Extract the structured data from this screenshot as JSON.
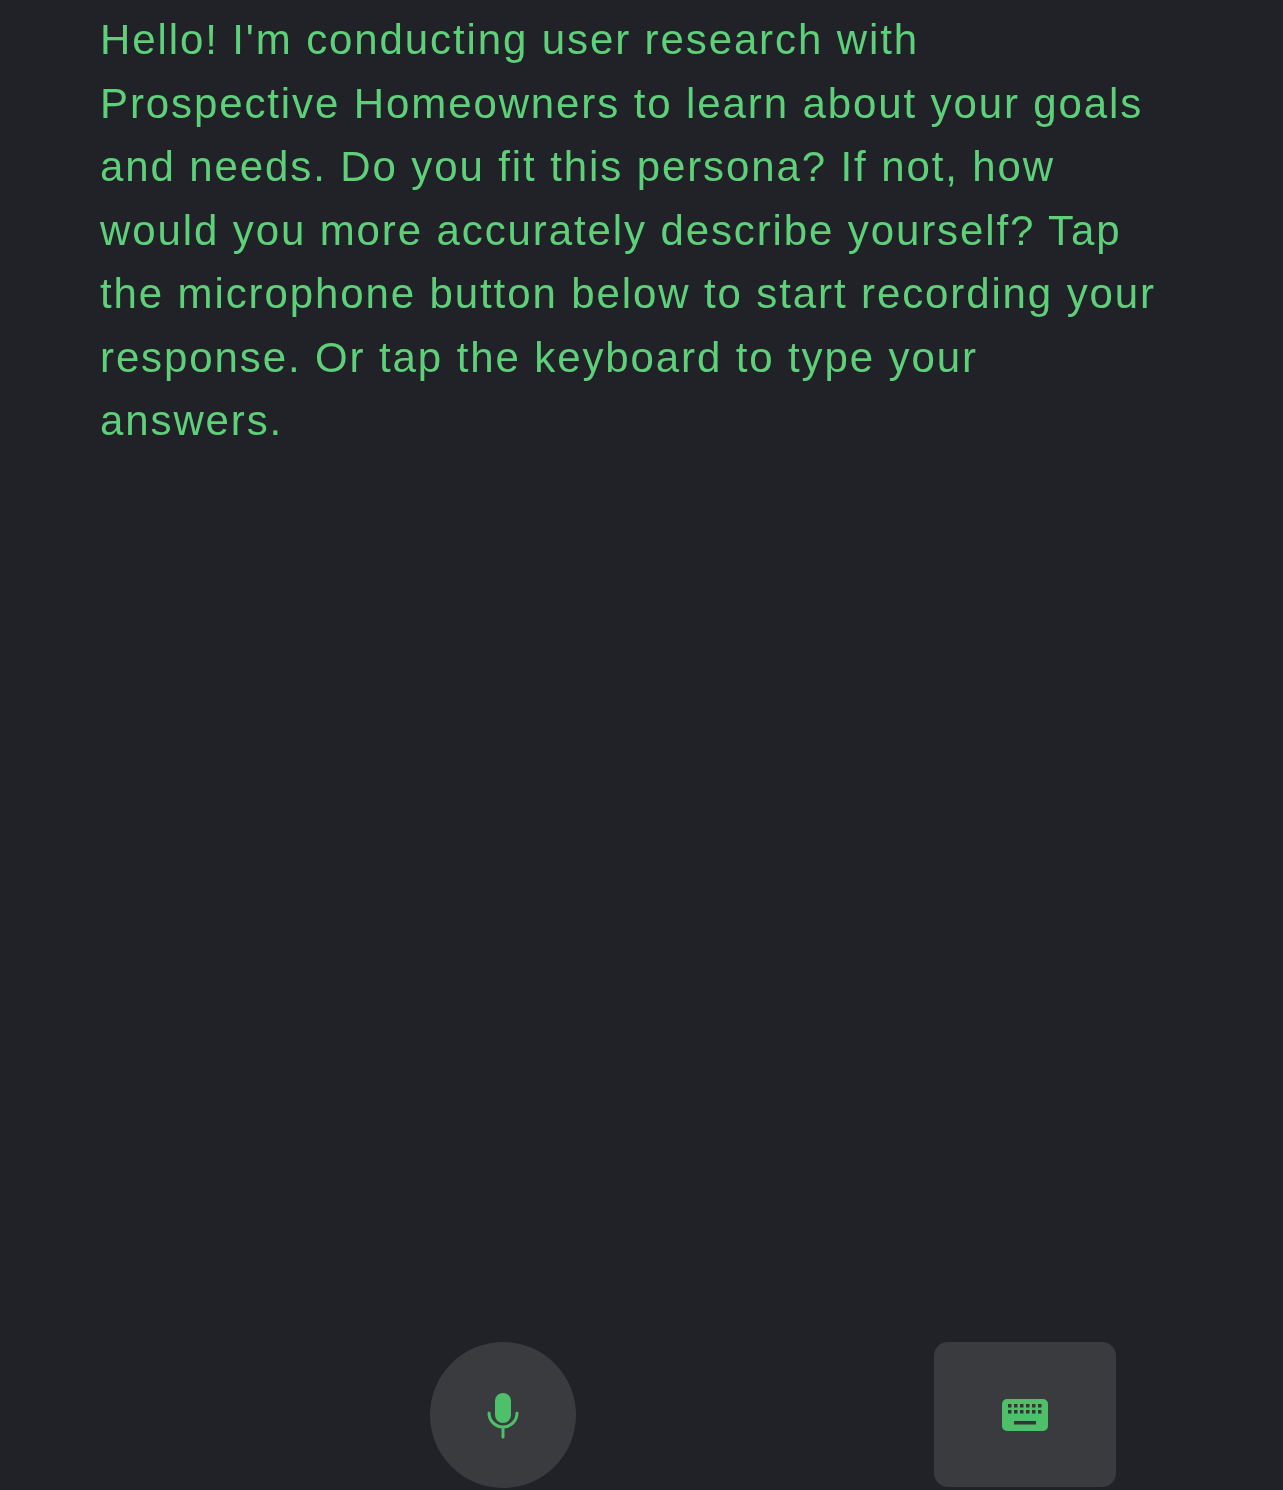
{
  "message": "Hello! I'm conducting user research with Prospective Homeowners to learn about your goals and needs. Do you fit this persona? If not, how would you more accurately describe yourself? Tap the microphone button below to start recording your response. Or tap the keyboard to type your answers.",
  "controls": [
    {
      "kind": "microphone"
    },
    {
      "kind": "keyboard"
    }
  ]
}
